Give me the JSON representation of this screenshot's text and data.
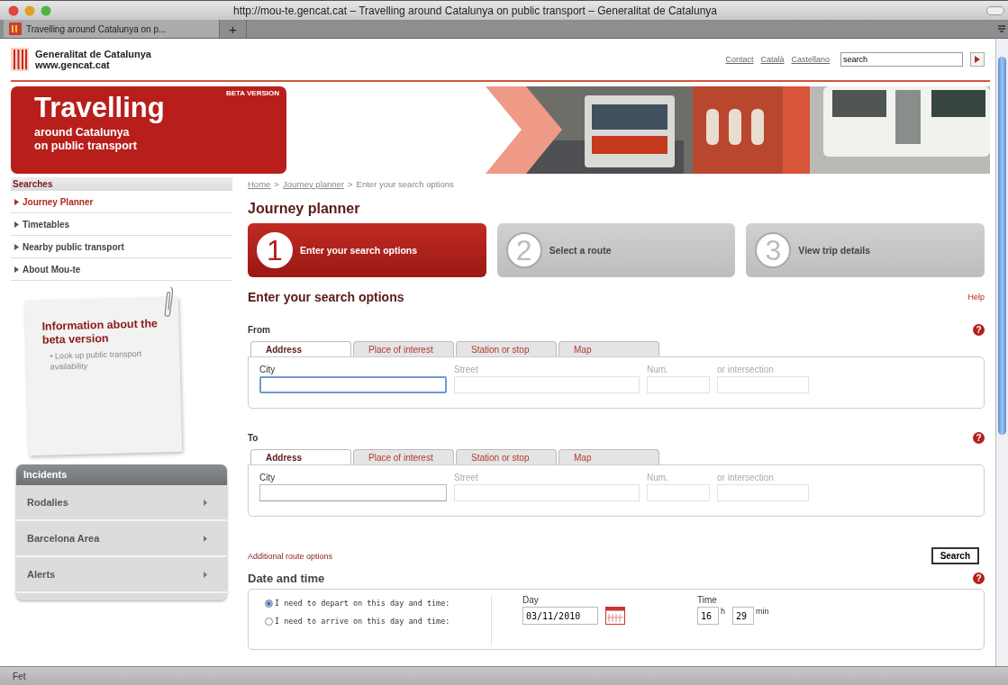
{
  "window": {
    "title": "http://mou-te.gencat.cat – Travelling around Catalunya on public transport – Generalitat de Catalunya",
    "tab_title": "Travelling around Catalunya on p...",
    "new_tab": "+"
  },
  "header": {
    "org_name": "Generalitat de Catalunya",
    "org_url": "www.gencat.cat",
    "links": [
      "Contact",
      "Català",
      "Castellano"
    ],
    "search": {
      "value": "search"
    }
  },
  "banner": {
    "beta": "BETA VERSION",
    "title": "Travelling",
    "subtitle": [
      "around Catalunya",
      "on public transport"
    ]
  },
  "sidebar": {
    "heading": "Searches",
    "items": [
      {
        "label": "Journey Planner",
        "selected": true
      },
      {
        "label": "Timetables",
        "selected": false
      },
      {
        "label": "Nearby public transport",
        "selected": false
      },
      {
        "label": "About Mou-te",
        "selected": false
      }
    ],
    "info": {
      "title": "Information about the beta version",
      "bullet": "• Look up public transport availability"
    },
    "incidents": {
      "heading": "Incidents",
      "items": [
        {
          "label": "Rodalies"
        },
        {
          "label": "Barcelona Area"
        },
        {
          "label": "Alerts"
        }
      ]
    }
  },
  "main": {
    "breadcrumb": [
      {
        "label": "Home",
        "kind": "link"
      },
      {
        "label": ">",
        "kind": "sep"
      },
      {
        "label": "Journey planner",
        "kind": "link"
      },
      {
        "label": ">",
        "kind": "sep"
      },
      {
        "label": "Enter your search options",
        "kind": "current"
      }
    ],
    "heading": "Journey planner",
    "steps": [
      {
        "number": "1",
        "label": "Enter your search options",
        "selected": true
      },
      {
        "number": "2",
        "label": "Select a route",
        "selected": false
      },
      {
        "number": "3",
        "label": "View trip details",
        "selected": false
      }
    ],
    "section_title": "Enter your search options",
    "help": "Help",
    "places": [
      {
        "label": "From",
        "help_mark": "?",
        "tabs": [
          {
            "label": "Address",
            "selected": true
          },
          {
            "label": "Place of interest",
            "selected": false
          },
          {
            "label": "Station or stop",
            "selected": false
          },
          {
            "label": "Map",
            "selected": false
          }
        ],
        "fields": [
          {
            "label": "City",
            "disabled": false,
            "focused": true
          },
          {
            "label": "Street",
            "disabled": true,
            "focused": false
          },
          {
            "label": "Num.",
            "disabled": true,
            "focused": false
          },
          {
            "label": "or intersection",
            "disabled": true,
            "focused": false
          }
        ]
      },
      {
        "label": "To",
        "help_mark": "?",
        "tabs": [
          {
            "label": "Address",
            "selected": true
          },
          {
            "label": "Place of interest",
            "selected": false
          },
          {
            "label": "Station or stop",
            "selected": false
          },
          {
            "label": "Map",
            "selected": false
          }
        ],
        "fields": [
          {
            "label": "City",
            "disabled": false,
            "focused": false
          },
          {
            "label": "Street",
            "disabled": true,
            "focused": false
          },
          {
            "label": "Num.",
            "disabled": true,
            "focused": false
          },
          {
            "label": "or intersection",
            "disabled": true,
            "focused": false
          }
        ]
      }
    ],
    "additional": "Additional route options",
    "search_button": "Search",
    "date": {
      "title": "Date and time",
      "help_mark": "?",
      "options": [
        {
          "label": "I need to depart on this day and time:",
          "selected": true
        },
        {
          "label": "I need to arrive on this day and time:",
          "selected": false
        }
      ],
      "day_label": "Day",
      "day_value": "03/11/2010",
      "time_label": "Time",
      "hour": "16",
      "hour_unit": "h",
      "minute": "29",
      "minute_unit": "min"
    }
  },
  "status_bar": "Fet"
}
